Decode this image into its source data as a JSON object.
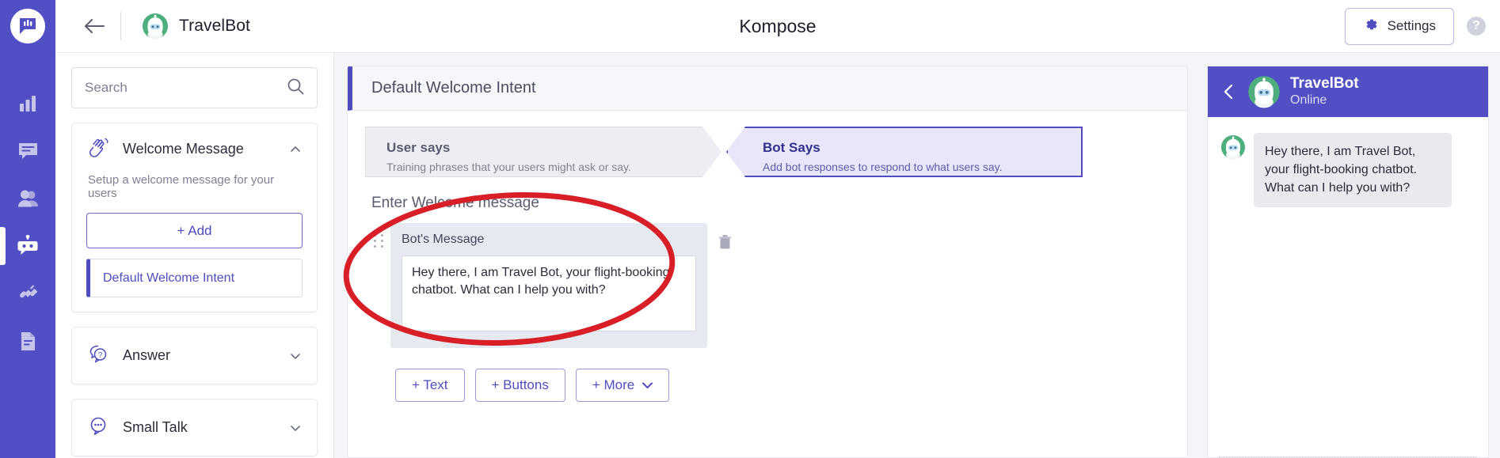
{
  "rail": {
    "logo_icon": "kompose-chat-logo-icon",
    "items": [
      {
        "icon": "analytics-bar-chart-icon",
        "name": "analytics",
        "active": false
      },
      {
        "icon": "chat-message-icon",
        "name": "conversations",
        "active": false
      },
      {
        "icon": "users-people-icon",
        "name": "users",
        "active": false
      },
      {
        "icon": "bot-icon",
        "name": "bot-builder",
        "active": true
      },
      {
        "icon": "plug-integration-icon",
        "name": "integrations",
        "active": false
      },
      {
        "icon": "document-file-icon",
        "name": "documents",
        "active": false
      }
    ]
  },
  "topbar": {
    "back_icon": "back-arrow-icon",
    "bot_name": "TravelBot",
    "bot_avatar_icon": "travelbot-avatar-icon",
    "page_title": "Kompose",
    "settings_label": "Settings",
    "settings_icon": "gear-icon",
    "help_label": "?",
    "help_icon": "help-circle-icon"
  },
  "search": {
    "placeholder": "Search",
    "value": "",
    "icon": "search-icon"
  },
  "left_panel": {
    "welcome_card": {
      "icon": "waving-hand-icon",
      "title": "Welcome Message",
      "subtitle": "Setup a welcome message for your users",
      "add_label": "+ Add",
      "collapse_icon": "chevron-up-icon",
      "intents": [
        {
          "label": "Default Welcome Intent",
          "selected": true
        }
      ]
    },
    "sections": [
      {
        "icon": "question-bubble-icon",
        "title": "Answer",
        "collapse_icon": "chevron-down-icon"
      },
      {
        "icon": "ellipsis-bubble-icon",
        "title": "Small Talk",
        "collapse_icon": "chevron-down-icon"
      }
    ]
  },
  "center": {
    "intent_header": "Default Welcome Intent",
    "tabs": [
      {
        "label": "User says",
        "sublabel": "Training phrases that your users might ask or say.",
        "active": false
      },
      {
        "label": "Bot Says",
        "sublabel": "Add bot responses to respond to what users say.",
        "active": true
      }
    ],
    "compose_label": "Enter Welcome message",
    "message_card": {
      "drag_icon": "drag-handle-icon",
      "title": "Bot's Message",
      "value": "Hey there, I am Travel Bot, your flight-booking chatbot. What can I help you with?",
      "placeholder": "",
      "delete_icon": "trash-icon"
    },
    "actions": [
      {
        "label": "+ Text",
        "icon": ""
      },
      {
        "label": "+ Buttons",
        "icon": ""
      },
      {
        "label": "+ More",
        "icon": "chevron-down-icon"
      }
    ]
  },
  "chat_preview": {
    "back_icon": "chevron-left-icon",
    "avatar_icon": "travelbot-avatar-icon",
    "name": "TravelBot",
    "status": "Online",
    "messages": [
      {
        "from": "bot",
        "text": "Hey there, I am Travel Bot, your flight-booking chatbot. What can I help you with?"
      }
    ]
  },
  "annotation": {
    "shape": "ellipse",
    "color": "#d81f28",
    "target": "bot-message-card"
  },
  "colors": {
    "brand_purple": "#524fc4",
    "accent_purple": "#4f4cc0",
    "tab_active_bg": "#e8e7fa",
    "bot_green": "#4caf7d",
    "annotation_red": "#d81f28"
  }
}
